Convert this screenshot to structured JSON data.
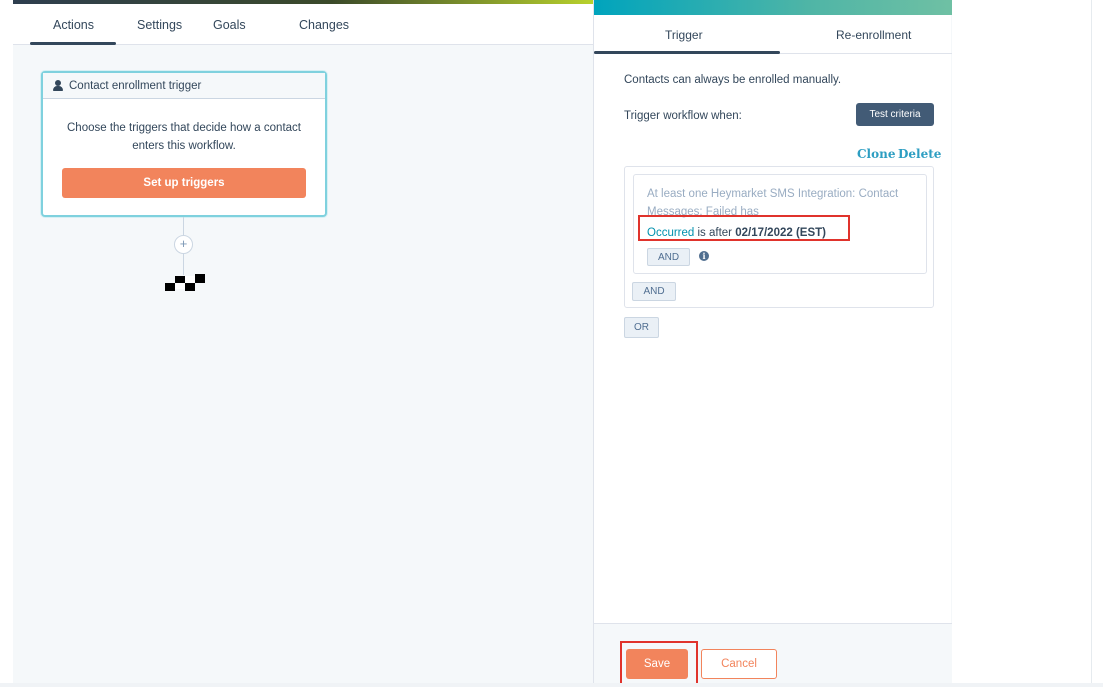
{
  "canvas": {
    "tabs": [
      {
        "label": "Actions"
      },
      {
        "label": "Settings"
      },
      {
        "label": "Goals"
      },
      {
        "label": "Changes"
      }
    ],
    "trigger_card": {
      "title": "Contact enrollment trigger",
      "icon": "person-icon",
      "description": "Choose the triggers that decide how a contact enters this workflow.",
      "button_label": "Set up triggers"
    },
    "add_action_symbol": "+",
    "end_icon": "checkered-flag-icon"
  },
  "panel": {
    "tabs": [
      {
        "label": "Trigger"
      },
      {
        "label": "Re-enrollment"
      }
    ],
    "manual_note": "Contacts can always be enrolled manually.",
    "trigger_when_label": "Trigger workflow when:",
    "test_button": "Test criteria",
    "clone_link": "Clone",
    "delete_link": "Delete",
    "filter": {
      "description": "At least one Heymarket SMS Integration: Contact Messages: Failed has",
      "condition_field": "Occurred",
      "condition_operator": " is after ",
      "condition_value": "02/17/2022 (EST)",
      "and_inner_label": "AND",
      "info_icon": "info-icon"
    },
    "and_outer_label": "AND",
    "or_label": "OR",
    "footer": {
      "save_label": "Save",
      "cancel_label": "Cancel"
    }
  },
  "colors": {
    "accent_orange": "#f2845c",
    "teal": "#00a4bd",
    "link_blue": "#2d9ec2",
    "highlight_red": "#e0332c",
    "dark_slate": "#425b76"
  }
}
